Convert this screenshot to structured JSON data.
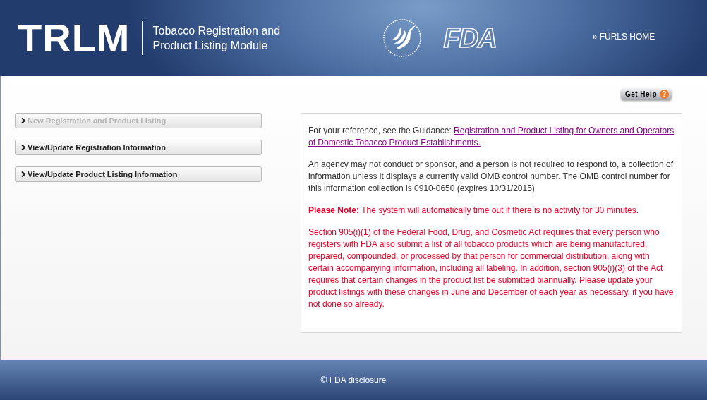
{
  "header": {
    "logo": "TRLM",
    "title_line_1": "Tobacco Registration and",
    "title_line_2": "Product Listing Module",
    "agency_logo": "FDA",
    "nav_link": {
      "marker": "»",
      "label": "FURLS HOME"
    }
  },
  "help_button": {
    "label": "Get Help",
    "icon": "?"
  },
  "menu": [
    {
      "label": "New Registration and Product Listing",
      "disabled": true
    },
    {
      "label": "View/Update Registration Information",
      "disabled": false
    },
    {
      "label": "View/Update Product Listing Information",
      "disabled": false
    }
  ],
  "info": {
    "reference_text": "For your reference, see the Guidance:",
    "reference_link": [
      "Registration and Product Listing for Owners and Operators",
      "of Domestic Tobacco Product Establishments."
    ],
    "paperwork_notice": "An agency may not conduct or sponsor, and a person is not required to respond to, a collection of information unless it displays a currently valid OMB control number. The OMB control number for this information collection is 0910-0650 (expires 10/31/2015)",
    "timeout_note": "**Please Note:** The system will automatically time out if there is no activity for 30 minutes.",
    "section_notice": "Section 905(i)(1) of the Federal Food, Drug, and Cosmetic Act requires that every person who registers with FDA also submit a list of all tobacco products which are being manufactured, prepared, compounded, or processed by that person for commercial distribution, along with certain accompanying information, including all labeling. In addition, section 905(i)(3) of the Act requires that certain changes in the product list be submitted biannually. Please update your product listings with these changes in June and December of each year as necessary, if you have not done so already."
  },
  "footer": {
    "text": "© FDA disclosure"
  }
}
